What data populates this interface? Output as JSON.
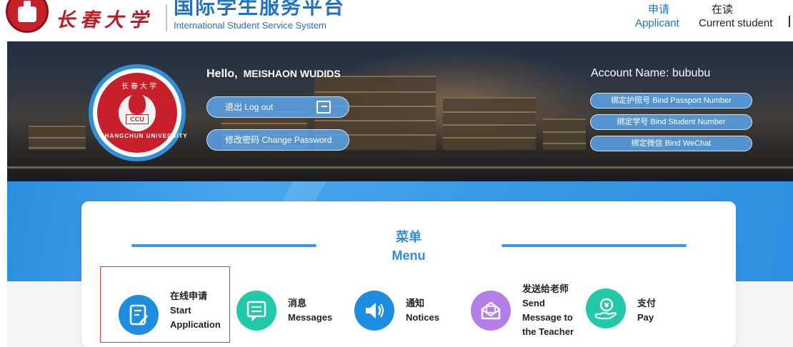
{
  "header": {
    "university_name_cn": "长春大学",
    "system_title_cn": "国际学生服务平台",
    "system_title_en": "International Student Service System",
    "nav": [
      {
        "label_cn": "申请",
        "label_en": "Applicant",
        "active": true
      },
      {
        "label_cn": "在读",
        "label_en": "Current student",
        "active": false
      }
    ]
  },
  "banner": {
    "seal": {
      "text_cn": "长春大学",
      "text_abbr": "CCU",
      "text_en": "CHANGCHUN UNIVERSITY"
    },
    "greeting": "Hello,",
    "user_name": "MEISHAON WUDIDS",
    "logout_label": "退出 Log out",
    "change_password_label": "修改密码 Change Password",
    "account_label": "Account Name:",
    "account_name": "bububu",
    "bind_passport_label": "绑定护照号 Bind Passport Number",
    "bind_student_label": "绑定学号 Bind Student Number",
    "bind_wechat_label": "绑定微信 Bind WeChat"
  },
  "menu": {
    "title_cn": "菜单",
    "title_en": "Menu",
    "items": [
      {
        "line1": "在线申请",
        "line2": "Start",
        "line3": "Application",
        "icon": "edit-document-icon",
        "color": "#1e8fe0"
      },
      {
        "line1": "消息",
        "line2": "Messages",
        "icon": "message-icon",
        "color": "#20c9a8"
      },
      {
        "line1": "通知",
        "line2": "Notices",
        "icon": "speaker-icon",
        "color": "#1e8fe0"
      },
      {
        "line1": "发送给老师",
        "line2": "Send",
        "line3": "Message to",
        "line4": "the Teacher",
        "icon": "mail-open-icon",
        "color": "#b47ee8"
      },
      {
        "line1": "支付",
        "line2": "Pay",
        "icon": "hand-coin-icon",
        "color": "#20c9a8"
      }
    ]
  },
  "colors": {
    "brand_blue": "#1d72c8",
    "accent_blue": "#2f8ee0",
    "university_red": "#c8202a",
    "highlight_border": "#e0402a"
  }
}
